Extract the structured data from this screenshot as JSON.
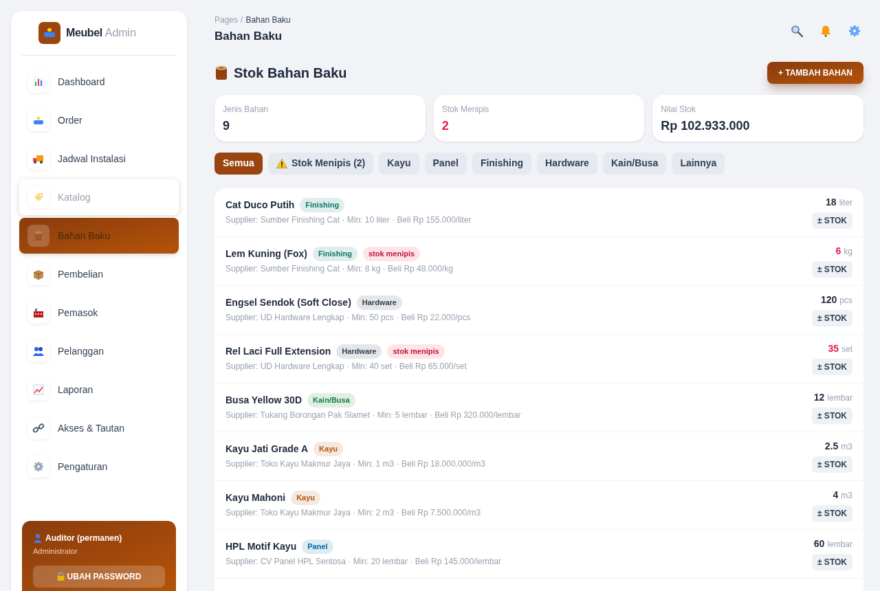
{
  "brand": {
    "name": "Meubel",
    "suffix": "Admin"
  },
  "nav": [
    {
      "label": "Dashboard",
      "selected": false,
      "hovered": false
    },
    {
      "label": "Order",
      "selected": false,
      "hovered": false
    },
    {
      "label": "Jadwal Instalasi",
      "selected": false,
      "hovered": false
    },
    {
      "label": "Katalog",
      "selected": false,
      "hovered": true
    },
    {
      "label": "Bahan Baku",
      "selected": true,
      "hovered": false
    },
    {
      "label": "Pembelian",
      "selected": false,
      "hovered": false
    },
    {
      "label": "Pemasok",
      "selected": false,
      "hovered": false
    },
    {
      "label": "Pelanggan",
      "selected": false,
      "hovered": false
    },
    {
      "label": "Laporan",
      "selected": false,
      "hovered": false
    },
    {
      "label": "Akses & Tautan",
      "selected": false,
      "hovered": false
    },
    {
      "label": "Pengaturan",
      "selected": false,
      "hovered": false
    }
  ],
  "user": {
    "name": "Auditor (permanen)",
    "role": "Administrator",
    "button": "UBAH PASSWORD"
  },
  "breadcrumb": {
    "parent": "Pages",
    "separator": "/",
    "current": "Bahan Baku"
  },
  "page_title": "Bahan Baku",
  "section_title": "Stok Bahan Baku",
  "add_button": "+ TAMBAH BAHAN",
  "stats": [
    {
      "label": "Jenis Bahan",
      "value": "9",
      "alert": false
    },
    {
      "label": "Stok Menipis",
      "value": "2",
      "alert": true
    },
    {
      "label": "Nilai Stok",
      "value": "Rp 102.933.000",
      "alert": false
    }
  ],
  "filters": [
    {
      "label": "Semua",
      "selected": true,
      "warning": false
    },
    {
      "label": "Stok Menipis (2)",
      "selected": false,
      "warning": true
    },
    {
      "label": "Kayu",
      "selected": false,
      "warning": false
    },
    {
      "label": "Panel",
      "selected": false,
      "warning": false
    },
    {
      "label": "Finishing",
      "selected": false,
      "warning": false
    },
    {
      "label": "Hardware",
      "selected": false,
      "warning": false
    },
    {
      "label": "Kain/Busa",
      "selected": false,
      "warning": false
    },
    {
      "label": "Lainnya",
      "selected": false,
      "warning": false
    }
  ],
  "materials": [
    {
      "name": "Cat Duco Putih",
      "category": {
        "label": "Finishing",
        "color": "#0f766e"
      },
      "detail": "Supplier: Sumber Finishing Cat · Min: 10 liter · Beli Rp 155.000/liter",
      "qty": "18",
      "unit": "liter",
      "low": false,
      "button": "± STOK"
    },
    {
      "name": "Lem Kuning (Fox)",
      "category": {
        "label": "Finishing",
        "color": "#0f766e"
      },
      "low_tag": "stok menipis",
      "detail": "Supplier: Sumber Finishing Cat · Min: 8 kg · Beli Rp 48.000/kg",
      "qty": "6",
      "unit": "kg",
      "low": true,
      "button": "± STOK"
    },
    {
      "name": "Engsel Sendok (Soft Close)",
      "category": {
        "label": "Hardware",
        "color": "#334155"
      },
      "detail": "Supplier: UD Hardware Lengkap · Min: 50 pcs · Beli Rp 22.000/pcs",
      "qty": "120",
      "unit": "pcs",
      "low": false,
      "button": "± STOK"
    },
    {
      "name": "Rel Laci Full Extension",
      "category": {
        "label": "Hardware",
        "color": "#334155"
      },
      "low_tag": "stok menipis",
      "detail": "Supplier: UD Hardware Lengkap · Min: 40 set · Beli Rp 65.000/set",
      "qty": "35",
      "unit": "set",
      "low": true,
      "button": "± STOK"
    },
    {
      "name": "Busa Yellow 30D",
      "category": {
        "label": "Kain/Busa",
        "color": "#15803d"
      },
      "detail": "Supplier: Tukang Borongan Pak Slamet · Min: 5 lembar · Beli Rp 320.000/lembar",
      "qty": "12",
      "unit": "lembar",
      "low": false,
      "button": "± STOK"
    },
    {
      "name": "Kayu Jati Grade A",
      "category": {
        "label": "Kayu",
        "color": "#b45309"
      },
      "detail": "Supplier: Toko Kayu Makmur Jaya · Min: 1 m3 · Beli Rp 18.000.000/m3",
      "qty": "2.5",
      "unit": "m3",
      "low": false,
      "button": "± STOK"
    },
    {
      "name": "Kayu Mahoni",
      "category": {
        "label": "Kayu",
        "color": "#b45309"
      },
      "detail": "Supplier: Toko Kayu Makmur Jaya · Min: 2 m3 · Beli Rp 7.500.000/m3",
      "qty": "4",
      "unit": "m3",
      "low": false,
      "button": "± STOK"
    },
    {
      "name": "HPL Motif Kayu",
      "category": {
        "label": "Panel",
        "color": "#0369a1"
      },
      "detail": "Supplier: CV Panel HPL Sentosa · Min: 20 lembar · Beli Rp 145.000/lembar",
      "qty": "60",
      "unit": "lembar",
      "low": false,
      "button": "± STOK"
    }
  ]
}
